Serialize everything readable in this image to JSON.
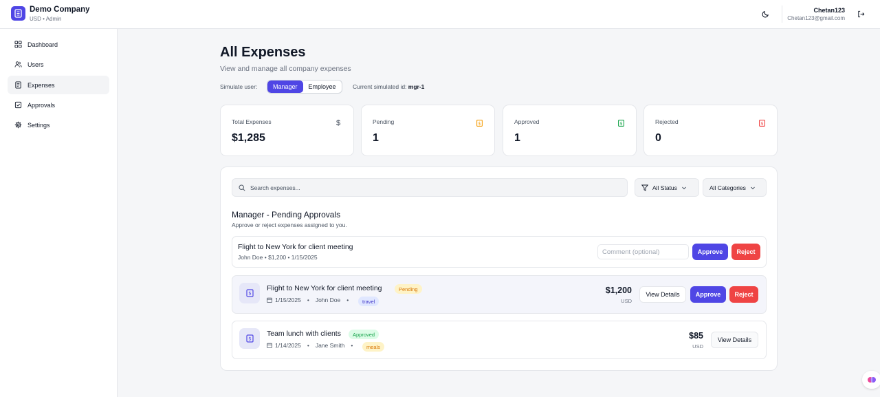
{
  "header": {
    "company_name": "Demo Company",
    "company_sub": "USD • Admin",
    "user_name": "Chetan123",
    "user_email": "Chetan123@gmail.com"
  },
  "sidebar": {
    "items": [
      {
        "label": "Dashboard",
        "icon": "grid-icon"
      },
      {
        "label": "Users",
        "icon": "users-icon"
      },
      {
        "label": "Expenses",
        "icon": "receipt-icon",
        "active": true
      },
      {
        "label": "Approvals",
        "icon": "check-square-icon"
      },
      {
        "label": "Settings",
        "icon": "gear-icon"
      }
    ]
  },
  "page": {
    "title": "All Expenses",
    "subtitle": "View and manage all company expenses",
    "simulate_label": "Simulate user:",
    "simulate_options": [
      "Manager",
      "Employee"
    ],
    "simulate_selected": "Manager",
    "simulated_id_label": "Current simulated id:",
    "simulated_id_value": "mgr-1"
  },
  "stats": [
    {
      "label": "Total Expenses",
      "value": "$1,285",
      "icon": "dollar-icon",
      "color": "#374151"
    },
    {
      "label": "Pending",
      "value": "1",
      "icon": "pending-receipt-icon",
      "color": "#f59e0b"
    },
    {
      "label": "Approved",
      "value": "1",
      "icon": "approved-receipt-icon",
      "color": "#16a34a"
    },
    {
      "label": "Rejected",
      "value": "0",
      "icon": "rejected-receipt-icon",
      "color": "#ef4444"
    }
  ],
  "filters": {
    "search_placeholder": "Search expenses...",
    "status_value": "All Status",
    "category_value": "All Categories"
  },
  "approvals_section": {
    "title": "Manager - Pending Approvals",
    "subtitle": "Approve or reject expenses assigned to you.",
    "item": {
      "title": "Flight to New York for client meeting",
      "meta": "John Doe • $1,200 • 1/15/2025",
      "comment_placeholder": "Comment (optional)",
      "approve_label": "Approve",
      "reject_label": "Reject"
    }
  },
  "expenses": [
    {
      "title": "Flight to New York for client meeting",
      "status": "Pending",
      "date": "1/15/2025",
      "employee": "John Doe",
      "category": "travel",
      "amount": "$1,200",
      "currency": "USD",
      "details_label": "View Details",
      "approve_label": "Approve",
      "reject_label": "Reject"
    },
    {
      "title": "Team lunch with clients",
      "status": "Approved",
      "date": "1/14/2025",
      "employee": "Jane Smith",
      "category": "meals",
      "amount": "$85",
      "currency": "USD",
      "details_label": "View Details"
    }
  ],
  "colors": {
    "accent": "#4f46e5",
    "reject": "#ef4444",
    "pending": "#d97706",
    "approved": "#16a34a"
  }
}
